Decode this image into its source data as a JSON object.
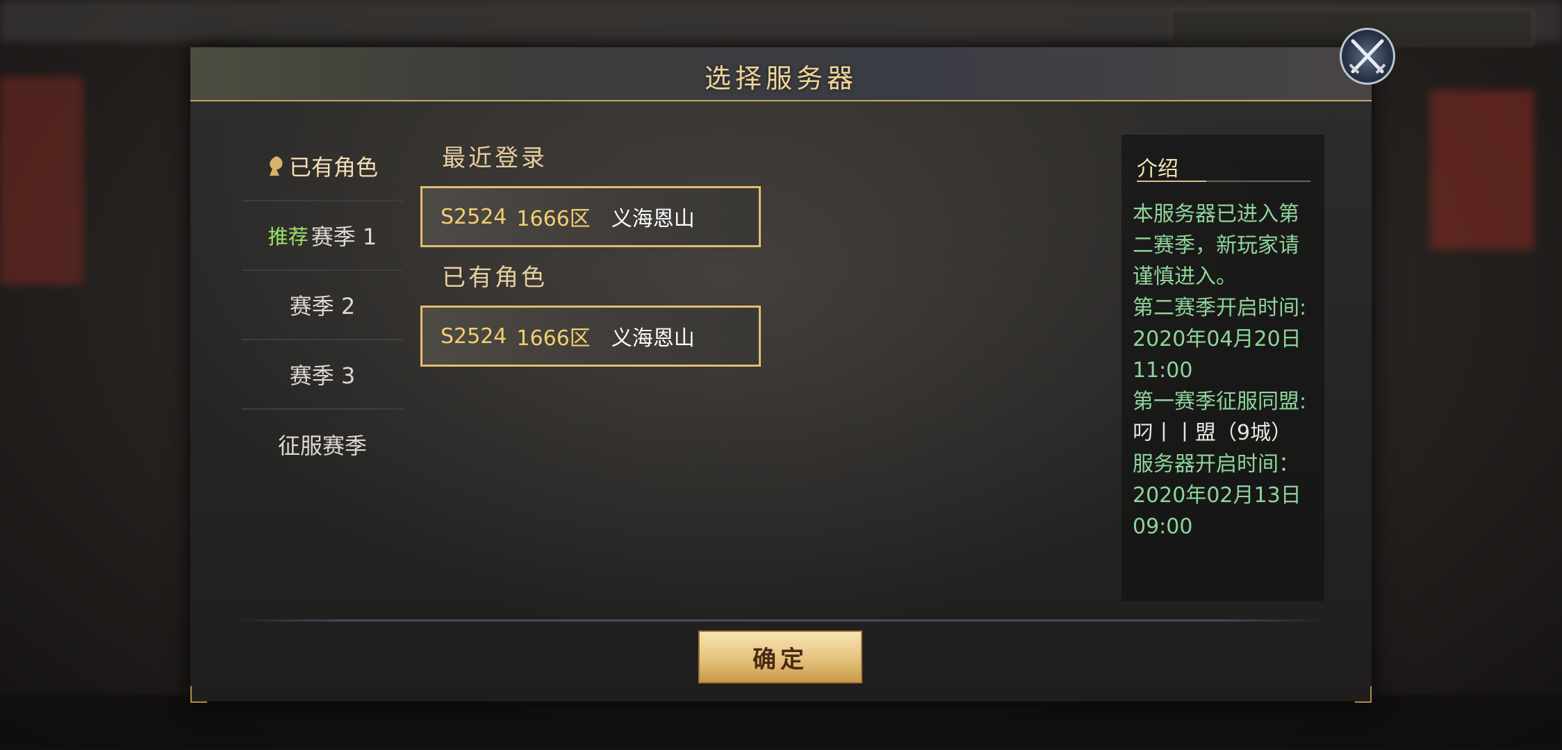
{
  "dialog": {
    "title": "选择服务器",
    "confirm_label": "确定"
  },
  "nav": {
    "items": [
      {
        "label": "已有角色",
        "active": true,
        "badge": ""
      },
      {
        "label": "赛季 1",
        "active": false,
        "badge": "推荐"
      },
      {
        "label": "赛季 2",
        "active": false,
        "badge": ""
      },
      {
        "label": "赛季 3",
        "active": false,
        "badge": ""
      },
      {
        "label": "征服赛季",
        "active": false,
        "badge": ""
      }
    ]
  },
  "recent": {
    "label": "最近登录",
    "server": {
      "id": "S2524",
      "zone": "1666区",
      "name": "义海恩山"
    }
  },
  "existing": {
    "label": "已有角色",
    "server": {
      "id": "S2524",
      "zone": "1666区",
      "name": "义海恩山"
    }
  },
  "info": {
    "title": "介绍",
    "lines": [
      "本服务器已进入第",
      "二赛季，新玩家请",
      "谨慎进入。",
      "第二赛季开启时间:",
      "2020年04月20日",
      "11:00",
      "第一赛季征服同盟:",
      "叼丨丨盟（9城）",
      "服务器开启时间：",
      "2020年02月13日",
      "09:00"
    ]
  },
  "icons": {
    "close": "crossed-swords-close-icon",
    "role": "character-icon"
  },
  "colors": {
    "title_gold": "#f1d49a",
    "server_gold": "#f3cf70",
    "info_green": "#8fd49a",
    "recommend_green": "#9be36a",
    "border_gold": "#e2bf6f"
  }
}
